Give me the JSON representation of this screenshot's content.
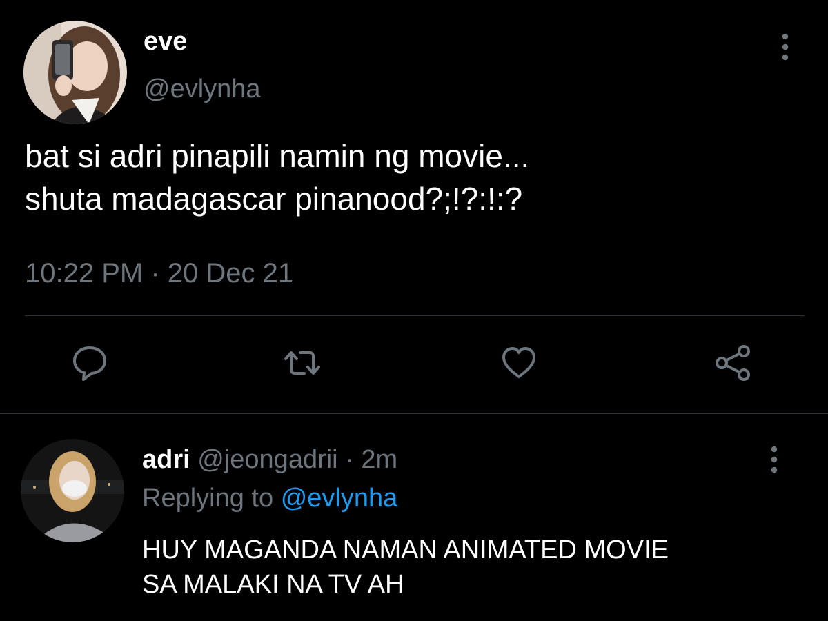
{
  "colors": {
    "background": "#000000",
    "primary_text": "#ffffff",
    "secondary_text": "#6e767d",
    "divider": "#2f3336",
    "link": "#1d9bf0"
  },
  "main_tweet": {
    "author_name": "eve",
    "author_handle": "@evlynha",
    "text_lines": [
      "bat si adri pinapili namin ng movie...",
      "shuta madagascar pinanood?;!?:!:?"
    ],
    "timestamp": "10:22 PM · 20 Dec 21",
    "more_icon": "more-vertical-icon",
    "actions": [
      {
        "name": "reply",
        "icon": "reply-icon"
      },
      {
        "name": "retweet",
        "icon": "retweet-icon"
      },
      {
        "name": "like",
        "icon": "heart-icon"
      },
      {
        "name": "share",
        "icon": "share-icon"
      }
    ]
  },
  "reply_tweet": {
    "author_name": "adri",
    "author_handle": "@jeongadrii",
    "separator": "·",
    "time_ago": "2m",
    "replying_prefix": "Replying to",
    "replying_handle": "@evlynha",
    "text_lines": [
      "HUY MAGANDA NAMAN ANIMATED MOVIE",
      "SA MALAKI NA TV AH"
    ],
    "more_icon": "more-vertical-icon"
  }
}
